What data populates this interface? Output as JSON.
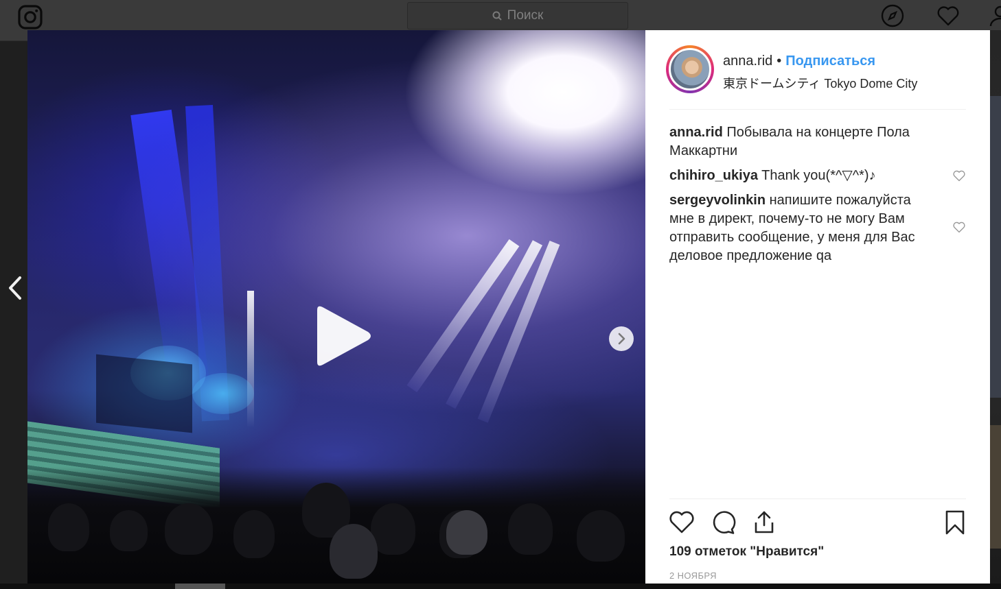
{
  "topbar": {
    "logo_icon": "instagram-logo-icon",
    "search_placeholder": "Поиск",
    "icons": [
      "compass-icon",
      "heart-icon",
      "profile-icon"
    ]
  },
  "post": {
    "username": "anna.rid",
    "separator": "•",
    "follow_label": "Подписаться",
    "location": "東京ドームシティ Tokyo Dome City",
    "caption": {
      "user": "anna.rid",
      "text": "Побывала на концерте Пола Маккартни"
    },
    "comments": [
      {
        "user": "chihiro_ukiya",
        "text": "Thank you(*^▽^*)♪"
      },
      {
        "user": "sergeyvolinkin",
        "text": "напишите пожалуйста мне в директ, почему-то не могу Вам отправить сообщение, у меня для Вас деловое предложение qa"
      }
    ],
    "likes": "109 отметок \"Нравится\"",
    "date": "2 НОЯБРЯ",
    "media_type": "video",
    "media_icons": [
      "play-icon",
      "chevron-right-icon"
    ]
  },
  "colors": {
    "follow": "#3897f0",
    "text": "#262626",
    "meta": "#999999",
    "overlay": "#1f1f1f"
  }
}
